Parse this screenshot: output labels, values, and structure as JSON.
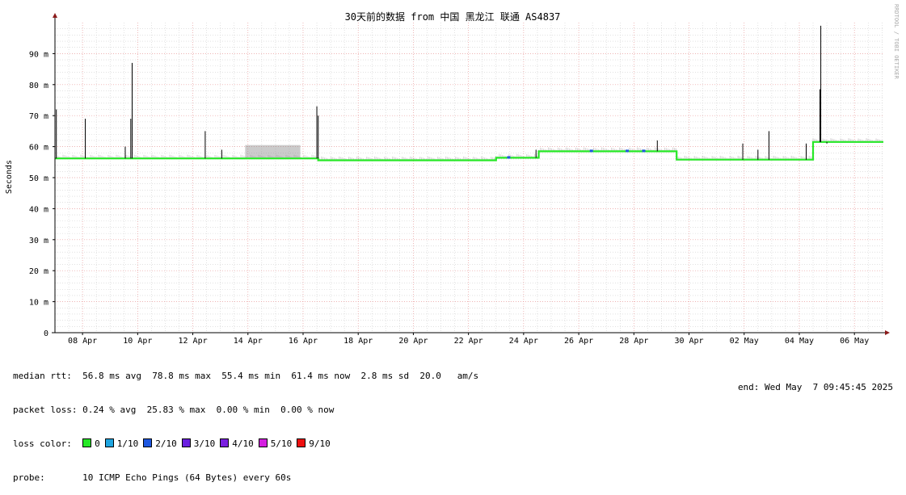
{
  "chart_data": {
    "type": "line",
    "title": "30天前的数据 from 中国 黑龙江 联通 AS4837",
    "ylabel": "Seconds",
    "xlabel": "",
    "side_watermark": "RRDTOOL / TOBI OETIKER",
    "ylim": [
      0,
      100
    ],
    "yticks": [
      0,
      10,
      20,
      30,
      40,
      50,
      60,
      70,
      80,
      90
    ],
    "ytick_labels": [
      "0",
      "10 m",
      "20 m",
      "30 m",
      "40 m",
      "50 m",
      "60 m",
      "70 m",
      "80 m",
      "90 m"
    ],
    "xlim": [
      7.0,
      37.05
    ],
    "x_unit": "days (April 2025)",
    "xticks": [
      8,
      10,
      12,
      14,
      16,
      18,
      20,
      22,
      24,
      26,
      28,
      30,
      32,
      34,
      36
    ],
    "xtick_labels": [
      "08 Apr",
      "10 Apr",
      "12 Apr",
      "14 Apr",
      "16 Apr",
      "18 Apr",
      "20 Apr",
      "22 Apr",
      "24 Apr",
      "26 Apr",
      "28 Apr",
      "30 Apr",
      "02 May",
      "04 May",
      "06 May"
    ],
    "grid": true,
    "colors": {
      "grid_major": "#e89a9a",
      "grid_minor": "#cfcfcf",
      "median_ok": "#26e826",
      "loss_1": "#1fa5e0",
      "loss_2": "#1e57e0",
      "spike": "#000000",
      "smoke": "#a8a8a8",
      "axis_arrow": "#8b1a1a"
    },
    "median_levels": [
      {
        "from": 7.0,
        "to": 16.55,
        "ms": 56.2
      },
      {
        "from": 16.55,
        "to": 23.0,
        "ms": 55.6
      },
      {
        "from": 23.0,
        "to": 24.55,
        "ms": 56.4
      },
      {
        "from": 24.55,
        "to": 29.55,
        "ms": 58.5
      },
      {
        "from": 29.55,
        "to": 34.5,
        "ms": 55.8
      },
      {
        "from": 34.5,
        "to": 37.05,
        "ms": 61.5
      }
    ],
    "spikes": [
      {
        "x": 7.05,
        "ms": 72
      },
      {
        "x": 8.1,
        "ms": 69
      },
      {
        "x": 9.55,
        "ms": 60
      },
      {
        "x": 9.75,
        "ms": 69
      },
      {
        "x": 9.8,
        "ms": 87
      },
      {
        "x": 12.45,
        "ms": 65
      },
      {
        "x": 13.05,
        "ms": 59
      },
      {
        "x": 16.5,
        "ms": 73
      },
      {
        "x": 16.55,
        "ms": 70
      },
      {
        "x": 24.45,
        "ms": 59
      },
      {
        "x": 28.85,
        "ms": 62
      },
      {
        "x": 31.95,
        "ms": 61
      },
      {
        "x": 32.5,
        "ms": 59
      },
      {
        "x": 32.9,
        "ms": 65
      },
      {
        "x": 34.25,
        "ms": 61
      },
      {
        "x": 34.75,
        "ms": 78.5
      },
      {
        "x": 34.78,
        "ms": 99
      },
      {
        "x": 35.0,
        "ms": 61
      }
    ],
    "smoke_band": {
      "from": 13.9,
      "to": 15.9,
      "low": 56.5,
      "high": 60.5
    }
  },
  "legend": {
    "median_rtt_label": "median rtt:",
    "median_rtt_values": "56.8 ms avg  78.8 ms max  55.4 ms min  61.4 ms now  2.8 ms sd  20.0   am/s",
    "packet_loss_label": "packet loss:",
    "packet_loss_values": "0.24 % avg  25.83 % max  0.00 % min  0.00 % now",
    "loss_color_label": "loss color:",
    "loss_colors": [
      {
        "label": "0",
        "color": "#26e826"
      },
      {
        "label": "1/10",
        "color": "#1fa5e0"
      },
      {
        "label": "2/10",
        "color": "#1e57e0"
      },
      {
        "label": "3/10",
        "color": "#6a1fe0"
      },
      {
        "label": "4/10",
        "color": "#7a1fe0"
      },
      {
        "label": "5/10",
        "color": "#d41fe0"
      },
      {
        "label": "9/10",
        "color": "#ee1010"
      }
    ],
    "probe_label": "probe:",
    "probe_value": "10 ICMP Echo Pings (64 Bytes) every 60s",
    "end_label": "end: Wed May  7 09:45:45 2025"
  }
}
